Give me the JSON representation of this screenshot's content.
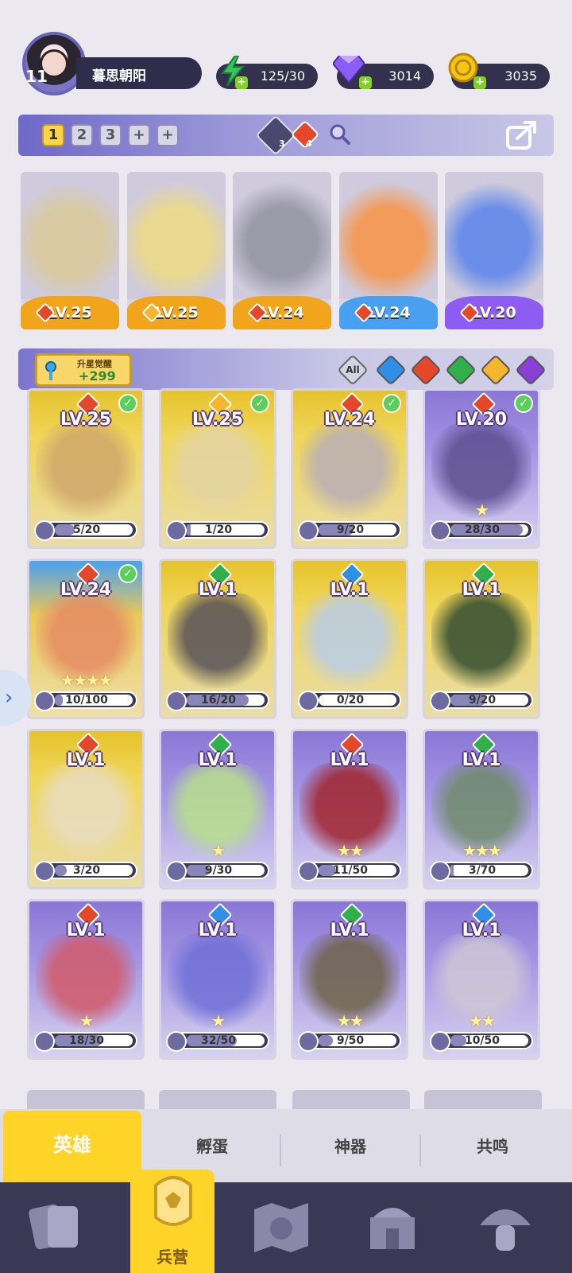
{
  "player": {
    "level": "11",
    "name": "暮思朝阳"
  },
  "resources": [
    {
      "icon": "lightning-icon",
      "value": "125/30",
      "color": "#35c45a"
    },
    {
      "icon": "gem-icon",
      "value": "3014",
      "color": "#8b5cf6"
    },
    {
      "icon": "coin-icon",
      "value": "3035",
      "color": "#f5b800"
    }
  ],
  "team": {
    "slots": [
      "1",
      "2",
      "3",
      "+",
      "+"
    ],
    "active_slot": "1",
    "crossbow_count": "3",
    "fire_count": "4"
  },
  "team_cards": [
    {
      "level": "LV.25",
      "element": "fire",
      "bar_color": "#f0a51c",
      "art_color": "#d8c9a3"
    },
    {
      "level": "LV.25",
      "element": "light",
      "bar_color": "#f0a51c",
      "art_color": "#e9d88f"
    },
    {
      "level": "LV.24",
      "element": "fire",
      "bar_color": "#f0a51c",
      "art_color": "#9a9aa8"
    },
    {
      "level": "LV.24",
      "element": "fire",
      "bar_color": "#4aa0f0",
      "art_color": "#f29b5a"
    },
    {
      "level": "LV.20",
      "element": "fire",
      "bar_color": "#8d5cf0",
      "art_color": "#6b8ee8"
    }
  ],
  "filter": {
    "awaken_label": "升星觉醒",
    "awaken_value": "+299",
    "all_label": "All",
    "elements": [
      "water",
      "fire",
      "wind",
      "light",
      "dark"
    ]
  },
  "heroes": [
    {
      "level": "LV.25",
      "element": "fire",
      "progress": "5/20",
      "ratio": 0.25,
      "checked": true,
      "rarity": "gold",
      "stars": "",
      "art": "#cfa66b"
    },
    {
      "level": "LV.25",
      "element": "light",
      "progress": "1/20",
      "ratio": 0.05,
      "checked": true,
      "rarity": "gold",
      "stars": "",
      "art": "#e3d4a3"
    },
    {
      "level": "LV.24",
      "element": "fire",
      "progress": "9/20",
      "ratio": 0.45,
      "checked": true,
      "rarity": "gold",
      "stars": "",
      "art": "#b9aeb6"
    },
    {
      "level": "LV.20",
      "element": "fire",
      "progress": "28/30",
      "ratio": 0.93,
      "checked": true,
      "rarity": "purple",
      "stars": "★",
      "art": "#5c4f8f"
    },
    {
      "level": "LV.24",
      "element": "fire",
      "progress": "10/100",
      "ratio": 0.1,
      "checked": true,
      "rarity": "gold-blue",
      "stars": "★★★★",
      "art": "#e58b63"
    },
    {
      "level": "LV.1",
      "element": "wind",
      "progress": "16/20",
      "ratio": 0.8,
      "checked": false,
      "rarity": "gold",
      "stars": "",
      "art": "#555058"
    },
    {
      "level": "LV.1",
      "element": "water",
      "progress": "0/20",
      "ratio": 0.0,
      "checked": false,
      "rarity": "gold",
      "stars": "",
      "art": "#b8cde8"
    },
    {
      "level": "LV.1",
      "element": "wind",
      "progress": "9/20",
      "ratio": 0.45,
      "checked": false,
      "rarity": "gold",
      "stars": "",
      "art": "#2f4a2f"
    },
    {
      "level": "LV.1",
      "element": "fire",
      "progress": "3/20",
      "ratio": 0.15,
      "checked": false,
      "rarity": "gold",
      "stars": "",
      "art": "#e8dcc0"
    },
    {
      "level": "LV.1",
      "element": "wind",
      "progress": "9/30",
      "ratio": 0.3,
      "checked": false,
      "rarity": "purple",
      "stars": "★",
      "art": "#b7e08a"
    },
    {
      "level": "LV.1",
      "element": "fire",
      "progress": "11/50",
      "ratio": 0.22,
      "checked": false,
      "rarity": "purple",
      "stars": "★★",
      "art": "#a0242c"
    },
    {
      "level": "LV.1",
      "element": "wind",
      "progress": "3/70",
      "ratio": 0.04,
      "checked": false,
      "rarity": "purple",
      "stars": "★★★",
      "art": "#6f8a6a"
    },
    {
      "level": "LV.1",
      "element": "fire",
      "progress": "18/30",
      "ratio": 0.6,
      "checked": false,
      "rarity": "purple",
      "stars": "★",
      "art": "#d15a6a"
    },
    {
      "level": "LV.1",
      "element": "water",
      "progress": "32/50",
      "ratio": 0.64,
      "checked": false,
      "rarity": "purple",
      "stars": "★",
      "art": "#6f6fd6"
    },
    {
      "level": "LV.1",
      "element": "wind",
      "progress": "9/50",
      "ratio": 0.18,
      "checked": false,
      "rarity": "purple",
      "stars": "★★",
      "art": "#6e6248"
    },
    {
      "level": "LV.1",
      "element": "water",
      "progress": "10/50",
      "ratio": 0.2,
      "checked": false,
      "rarity": "purple",
      "stars": "★★",
      "art": "#cfc7d6"
    }
  ],
  "tabs": {
    "heroes": "英雄",
    "hatch": "孵蛋",
    "artifact": "神器",
    "resonance": "共鸣"
  },
  "nav": {
    "barracks": "兵营"
  },
  "element_colors": {
    "fire": "#e4472a",
    "light": "#f3b62c",
    "water": "#2f8fe6",
    "wind": "#2fb04a",
    "dark": "#8a3fd6"
  }
}
